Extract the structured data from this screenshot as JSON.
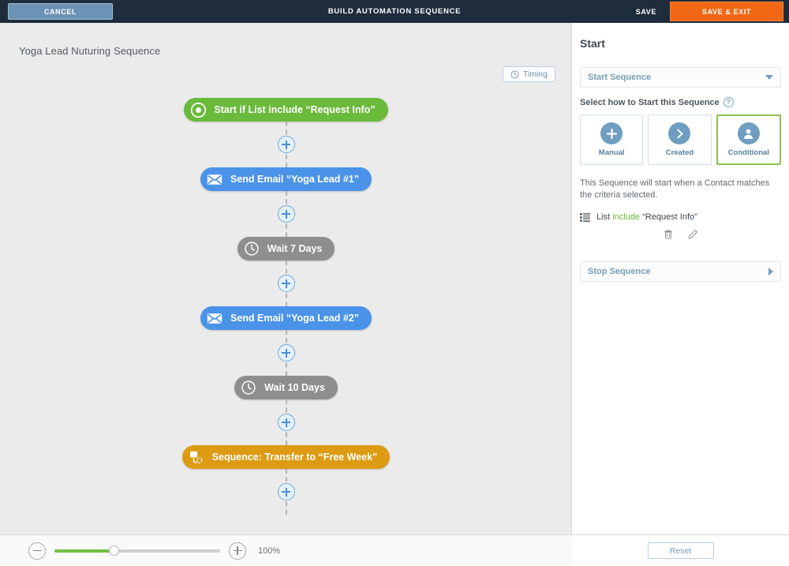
{
  "topbar": {
    "cancel_label": "CANCEL",
    "title": "BUILD AUTOMATION SEQUENCE",
    "save_label": "SAVE",
    "save_exit_label": "SAVE & EXIT",
    "bg_color": "#1e2c3c",
    "save_exit_color": "#f26716"
  },
  "canvas": {
    "sequence_title": "Yoga Lead Nuturing Sequence",
    "timing_label": "Timing",
    "nodes": [
      {
        "label": "Start if List include “Request Info”",
        "type": "green",
        "icon": "target-icon",
        "color": "#6aba3b"
      },
      {
        "label": "Send Email “Yoga Lead #1”",
        "type": "blue",
        "icon": "envelope-icon",
        "color": "#4a93e8"
      },
      {
        "label": "Wait 7 Days",
        "type": "gray",
        "icon": "clock-icon",
        "color": "#8e8e8e"
      },
      {
        "label": "Send Email “Yoga Lead #2”",
        "type": "blue",
        "icon": "envelope-icon",
        "color": "#4a93e8"
      },
      {
        "label": "Wait 10 Days",
        "type": "gray",
        "icon": "clock-icon",
        "color": "#8e8e8e"
      },
      {
        "label": "Sequence: Transfer to “Free Week”",
        "type": "orange",
        "icon": "transfer-icon",
        "color": "#dd9b14"
      }
    ]
  },
  "zoombar": {
    "zoom_out_icon": "minus-circle-icon",
    "zoom_in_icon": "plus-circle-icon",
    "zoom_value": "100%"
  },
  "panel": {
    "title": "Start",
    "start_select_value": "Start Sequence",
    "select_how_label": "Select how to Start this Sequence",
    "help_icon": "?",
    "cards": [
      {
        "label": "Manual",
        "icon": "plus-circle-icon",
        "selected": false
      },
      {
        "label": "Created",
        "icon": "chevron-right-icon",
        "selected": false
      },
      {
        "label": "Conditional",
        "icon": "person-icon",
        "selected": true
      }
    ],
    "selected_accent": "#8cc152",
    "description": "This Sequence will start when a Contact matches the criteria selected.",
    "criteria": {
      "field": "List",
      "operator": "include",
      "value": "“Request Info”",
      "operator_color": "#6aba3b",
      "delete_icon": "trash-icon",
      "edit_icon": "pencil-icon"
    },
    "stop_select_value": "Stop Sequence",
    "reset_label": "Reset"
  }
}
